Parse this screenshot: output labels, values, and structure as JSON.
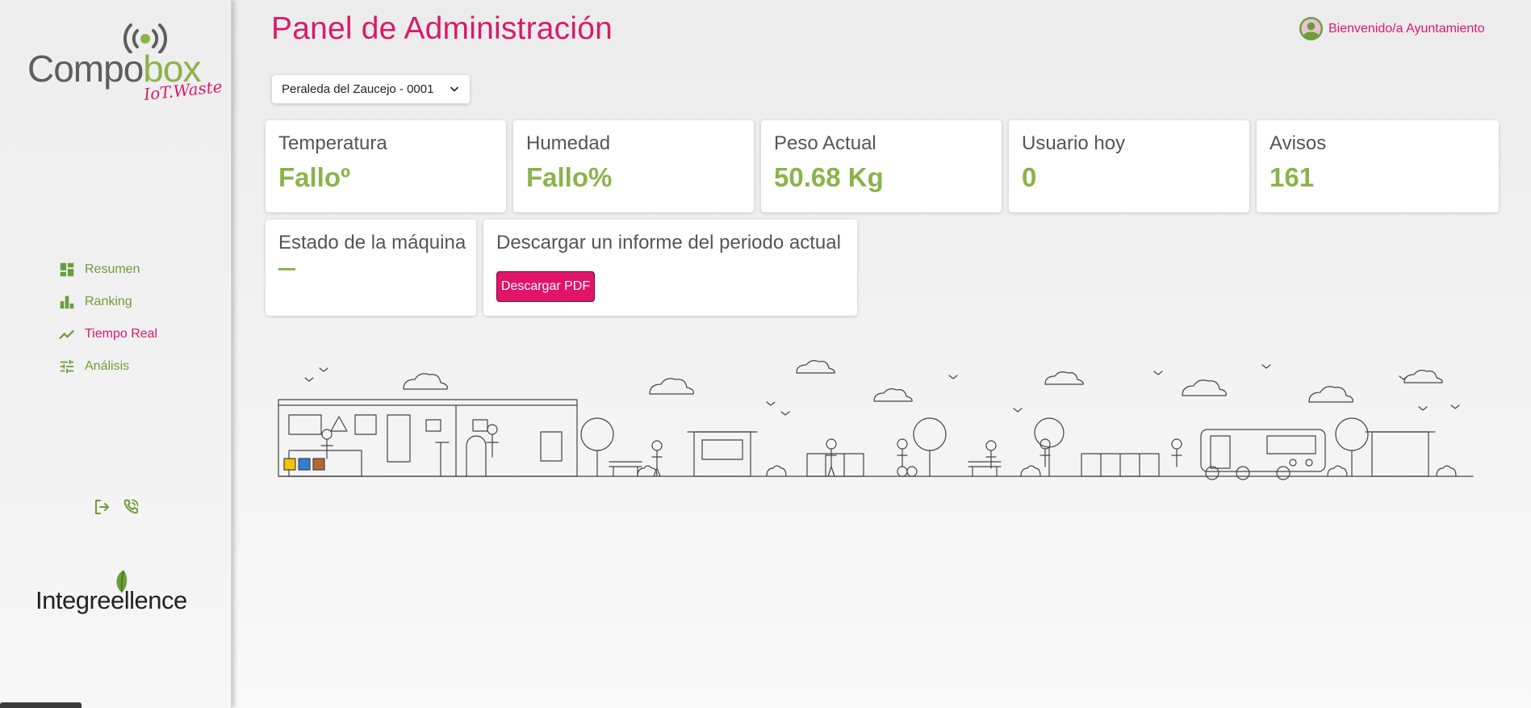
{
  "brand": {
    "name_part1": "Compo",
    "name_part2": "box",
    "tagline": "IoT.Waste",
    "partner_logo": "Integreellence",
    "colors": {
      "accent": "#d81b6a",
      "green": "#8cb34a",
      "nav_green": "#6b9e3a"
    }
  },
  "sidebar": {
    "items": [
      {
        "label": "Resumen",
        "icon": "dashboard-icon",
        "active": false
      },
      {
        "label": "Ranking",
        "icon": "bar-chart-icon",
        "active": false
      },
      {
        "label": "Tiempo Real",
        "icon": "trending-icon",
        "active": true
      },
      {
        "label": "Análisis",
        "icon": "tune-icon",
        "active": false
      }
    ],
    "actions": [
      {
        "icon": "logout-icon"
      },
      {
        "icon": "phone-icon"
      }
    ]
  },
  "header": {
    "title": "Panel de Administración",
    "welcome": "Bienvenido/a Ayuntamiento"
  },
  "selector": {
    "value": "Peraleda del Zaucejo - 0001"
  },
  "stats": [
    {
      "label": "Temperatura",
      "value": "Falloº"
    },
    {
      "label": "Humedad",
      "value": "Fallo%"
    },
    {
      "label": "Peso Actual",
      "value": "50.68 Kg"
    },
    {
      "label": "Usuario hoy",
      "value": "0"
    },
    {
      "label": "Avisos",
      "value": "161"
    }
  ],
  "machine": {
    "label": "Estado de la máquina"
  },
  "report": {
    "label": "Descargar un informe del periodo actual",
    "button": "Descargar PDF"
  }
}
